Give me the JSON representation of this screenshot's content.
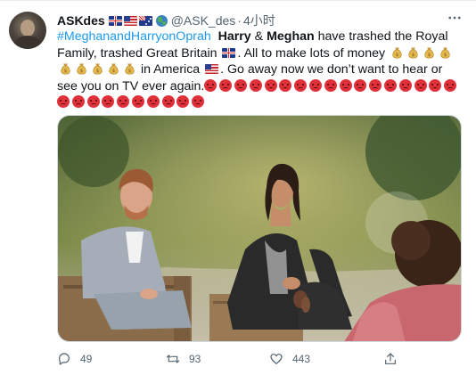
{
  "tweet": {
    "display_name": "ASKdes",
    "handle": "@ASK_des",
    "separator": "·",
    "timestamp": "4小时",
    "text": {
      "hashtag": "#MeghanandHarryonOprah",
      "name1": "Harry",
      "amp": " & ",
      "name2": "Meghan",
      "part1": " have trashed the Royal Family, trashed Great Britain",
      "part2": ". All to make lots of money",
      "part3": " in America",
      "part4": ". Go away now we don’t want to hear or see you on TV ever again."
    },
    "media_alt": "Harry and Meghan seated in an outdoor garden interview",
    "stats": {
      "replies": "49",
      "retweets": "93",
      "likes": "443"
    }
  },
  "icons": {
    "more": "more-dots-icon",
    "reply": "reply-icon",
    "retweet": "retweet-icon",
    "like": "heart-icon",
    "share": "share-icon",
    "money": "money-bag-icon",
    "angry": "angry-face-icon",
    "globe": "globe-icon"
  },
  "colors": {
    "link": "#1d9bf0",
    "secondary": "#536471",
    "text": "#0f1419"
  }
}
